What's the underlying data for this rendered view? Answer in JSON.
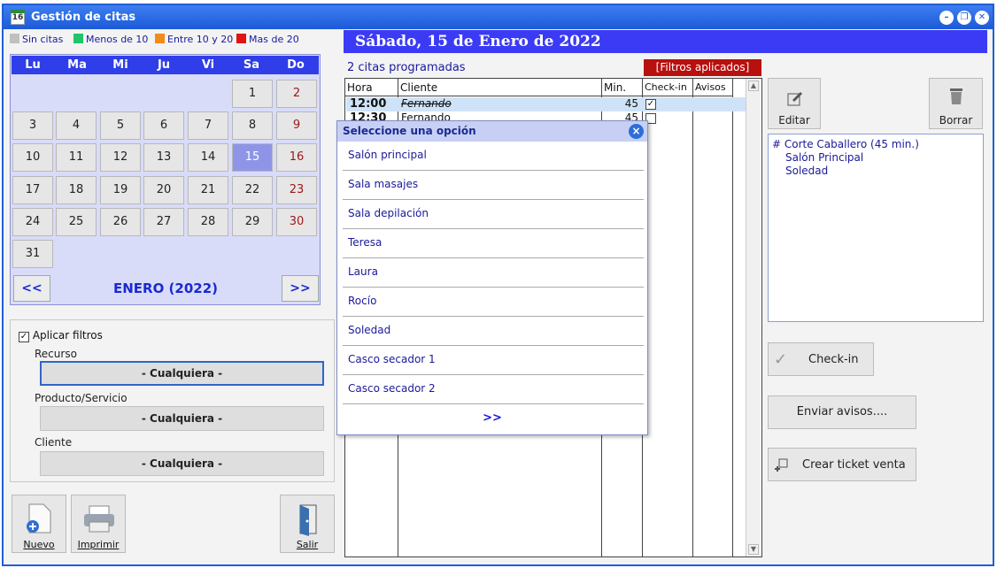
{
  "window": {
    "title": "Gestión de citas"
  },
  "legend": [
    {
      "label": "Sin citas",
      "color": "#c0c0c0"
    },
    {
      "label": "Menos de 10",
      "color": "#22c46a"
    },
    {
      "label": "Entre 10 y 20",
      "color": "#f28a1c"
    },
    {
      "label": "Mas de 20",
      "color": "#e01414"
    }
  ],
  "calendar": {
    "weekdays": [
      "Lu",
      "Ma",
      "Mi",
      "Ju",
      "Vi",
      "Sa",
      "Do"
    ],
    "days": [
      "1",
      "2",
      "3",
      "4",
      "5",
      "6",
      "7",
      "8",
      "9",
      "10",
      "11",
      "12",
      "13",
      "14",
      "15",
      "16",
      "17",
      "18",
      "19",
      "20",
      "21",
      "22",
      "23",
      "24",
      "25",
      "26",
      "27",
      "28",
      "29",
      "30",
      "31"
    ],
    "selected_day": "15",
    "month_label": "ENERO  (2022)",
    "prev_label": "<<",
    "next_label": ">>"
  },
  "filters": {
    "apply_label": "Aplicar filtros",
    "apply_checked": "✓",
    "resource_label": "Recurso",
    "resource_value": "- Cualquiera -",
    "product_label": "Producto/Servicio",
    "product_value": "- Cualquiera -",
    "client_label": "Cliente",
    "client_value": "- Cualquiera -"
  },
  "buttons": {
    "new": "Nuevo",
    "print": "Imprimir",
    "exit": "Salir",
    "edit": "Editar",
    "delete": "Borrar",
    "checkin": "Check-in",
    "send_notices": "Enviar avisos....",
    "create_ticket": "Crear ticket venta"
  },
  "day_header": "Sábado, 15 de Enero de 2022",
  "appointments_count": "2 citas programadas",
  "filters_badge": "[Filtros aplicados]",
  "grid": {
    "columns": [
      "Hora",
      "Cliente",
      "Min.",
      "Check-in",
      "Avisos"
    ],
    "rows": [
      {
        "hora": "12:00",
        "cliente": "Fernando",
        "min": "45",
        "checkin": "✓"
      },
      {
        "hora": "12:30",
        "cliente": "Fernando",
        "min": "45",
        "checkin": ""
      }
    ]
  },
  "popup": {
    "title": "Seleccione una opción",
    "close": "×",
    "options": [
      "Salón principal",
      "Sala masajes",
      "Sala depilación",
      "Teresa",
      "Laura",
      "Rocío",
      "Soledad",
      "Casco secador 1",
      "Casco secador 2"
    ],
    "more": ">>"
  },
  "detail": {
    "lines": [
      "# Corte Caballero  (45 min.)",
      "Salón Principal",
      "Soledad"
    ]
  }
}
